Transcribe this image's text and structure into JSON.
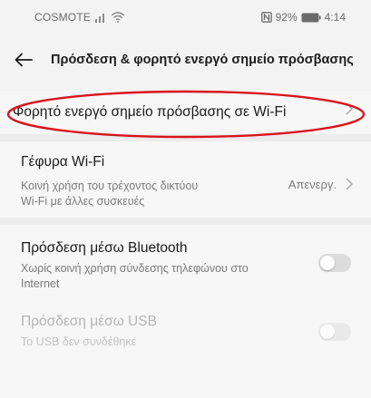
{
  "status_bar": {
    "carrier": "COSMOTE",
    "battery": "92%",
    "time": "4:14",
    "signal_icon": "signal-bars-icon",
    "wifi_icon": "wifi-icon",
    "nfc_icon": "nfc-icon",
    "battery_icon": "battery-icon"
  },
  "app_bar": {
    "title": "Πρόσδεση & φορητό ενεργό σημείο πρόσβασης",
    "back_icon": "back-arrow-icon"
  },
  "items": {
    "hotspot": {
      "label": "Φορητό ενεργό σημείο πρόσβασης σε Wi-Fi"
    },
    "wifi_bridge": {
      "label": "Γέφυρα Wi-Fi",
      "subtitle_line1": "Κοινή χρήση του τρέχοντος δικτύου",
      "subtitle_line2": "Wi-Fi με άλλες συσκευές",
      "value": "Απενεργ."
    },
    "bluetooth": {
      "label": "Πρόσδεση μέσω Bluetooth",
      "subtitle_line1": "Χωρίς κοινή χρήση σύνδεσης τηλεφώνου στο",
      "subtitle_line2": "Internet",
      "enabled": false
    },
    "usb": {
      "label": "Πρόσδεση μέσω USB",
      "subtitle": "Το USB δεν συνδέθηκε",
      "enabled": false,
      "disabled": true
    }
  },
  "colors": {
    "background": "#f3f3f3",
    "annotation_ellipse": "#d8141b",
    "toggle_off": "#dcdcdc"
  }
}
